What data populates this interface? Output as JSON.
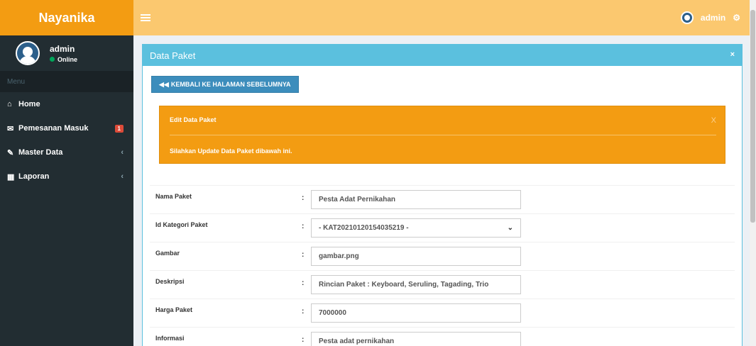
{
  "app": {
    "brand": "Nayanika"
  },
  "topbar": {
    "user": "admin",
    "gear_icon": "gear-icon"
  },
  "sidebar": {
    "user_name": "admin",
    "status": "Online",
    "menu_header": "Menu",
    "items": [
      {
        "label": "Home",
        "icon": "home-icon"
      },
      {
        "label": "Pemesanan Masuk",
        "icon": "envelope-icon",
        "badge": "1"
      },
      {
        "label": "Master Data",
        "icon": "edit-icon",
        "chevron": "‹"
      },
      {
        "label": "Laporan",
        "icon": "calendar-icon",
        "chevron": "‹"
      }
    ]
  },
  "panel": {
    "title": "Data Paket",
    "close": "×",
    "back_button": "KEMBALI KE HALAMAN SEBELUMNYA",
    "alert": {
      "title": "Edit Data Paket",
      "close": "X",
      "text": "Silahkan Update Data Paket dibawah ini."
    }
  },
  "form": {
    "colon": ":",
    "fields": [
      {
        "label": "Nama Paket",
        "value": "Pesta Adat Pernikahan"
      },
      {
        "label": "Id Kategori Paket",
        "value": "- KAT20210120154035219 -"
      },
      {
        "label": "Gambar",
        "value": "gambar.png"
      },
      {
        "label": "Deskripsi",
        "value": "Rincian Paket : Keyboard, Seruling, Tagading, Trio"
      },
      {
        "label": "Harga Paket",
        "value": "7000000"
      },
      {
        "label": "Informasi",
        "value": "Pesta adat pernikahan"
      }
    ]
  },
  "colors": {
    "brand": "#f39c12",
    "navbar": "#fbc86f",
    "sidebar": "#222d32",
    "box_header": "#5bc0de",
    "button": "#3c8dbc",
    "alert": "#f39c12",
    "badge": "#dd4b39"
  }
}
